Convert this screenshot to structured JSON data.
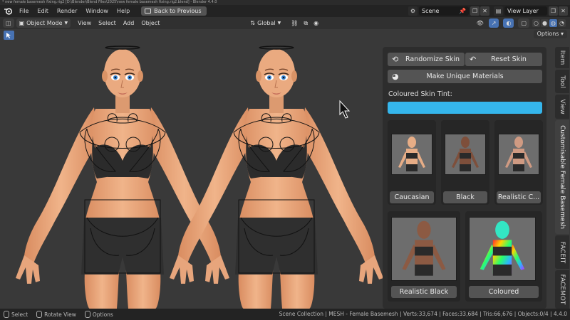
{
  "window": {
    "title": "* new female basemesh fixing.rig2 [D:\\Blender\\Blend Files\\2025\\new female basemesh fixing.rig2.blend] - Blender 4.4.0"
  },
  "topbar": {
    "menus": [
      "File",
      "Edit",
      "Render",
      "Window",
      "Help"
    ],
    "back_button": "Back to Previous",
    "scene_label": "Scene",
    "view_layer_label": "View Layer"
  },
  "header": {
    "mode": "Object Mode",
    "menus": [
      "View",
      "Select",
      "Add",
      "Object"
    ],
    "orientation": "Global",
    "options_label": "Options"
  },
  "panel": {
    "randomize_label": "Randomize Skin",
    "reset_label": "Reset Skin",
    "unique_materials_label": "Make Unique Materials",
    "tint_label": "Coloured Skin Tint:",
    "tint_color": "#35b6ec",
    "presets": [
      {
        "label": "Caucasian",
        "skin": "#e7ad86"
      },
      {
        "label": "Black",
        "skin": "#7e4f3b"
      },
      {
        "label": "Realistic C...",
        "skin": "#cf9a82"
      },
      {
        "label": "Realistic Black",
        "skin": "#8c5a43"
      },
      {
        "label": "Coloured",
        "skin": "rainbow"
      }
    ]
  },
  "tabs": {
    "item": "Item",
    "tool": "Tool",
    "view": "View",
    "addon": "Customisable Female Basemesh",
    "faceit": "FACEIT",
    "facemot": "FACEMOT"
  },
  "statusbar": {
    "select": "Select",
    "rotate": "Rotate View",
    "options": "Options",
    "stats": "Scene Collection | MESH - Female Basemesh | Verts:33,674 | Faces:33,684 | Tris:66,676 | Objects:0/4 | 4.4.0"
  },
  "colors": {
    "viewport_bg": "#393939",
    "accent": "#4772b3",
    "skin": "#e7a57c"
  }
}
